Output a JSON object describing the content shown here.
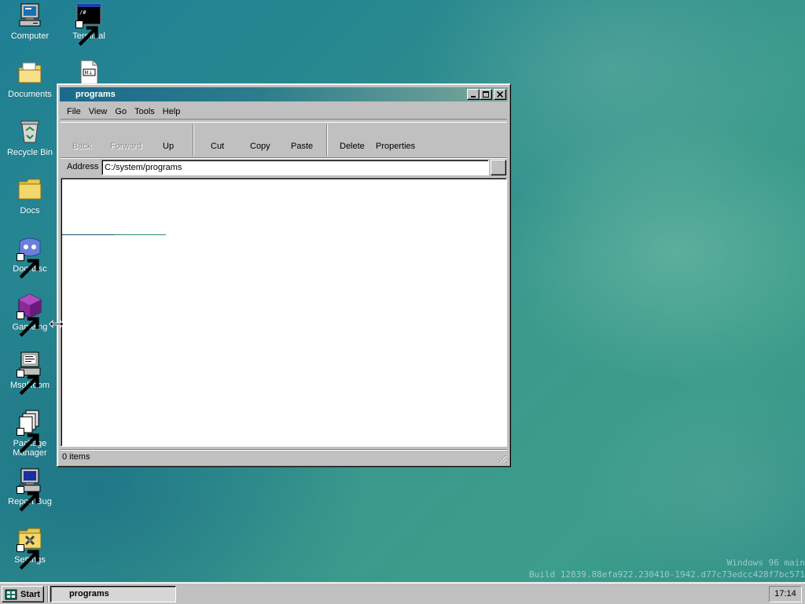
{
  "desktop": {
    "icons": [
      {
        "label": "Computer",
        "icon": "computer-icon"
      },
      {
        "label": "Terminal",
        "icon": "terminal-icon"
      },
      {
        "label": "Documents",
        "icon": "folder-documents-icon"
      },
      {
        "label": "Recycle Bin",
        "icon": "recycle-bin-icon"
      },
      {
        "label": "Docs",
        "icon": "folder-icon"
      },
      {
        "label": "Doordisc",
        "icon": "doordisc-icon"
      },
      {
        "label": "Gameing",
        "icon": "cube-icon"
      },
      {
        "label": "MsgRoom",
        "icon": "msgroom-icon"
      },
      {
        "label": "Package Manager",
        "icon": "package-manager-icon"
      },
      {
        "label": "Report Bug",
        "icon": "report-bug-icon"
      },
      {
        "label": "Settings",
        "icon": "settings-icon"
      }
    ],
    "file_icon": "markdown-file-icon",
    "file_icon_text": "M↓"
  },
  "window": {
    "title": "programs",
    "menu": [
      "File",
      "View",
      "Go",
      "Tools",
      "Help"
    ],
    "toolbar": {
      "back": "Back",
      "forward": "Forward",
      "up": "Up",
      "cut": "Cut",
      "copy": "Copy",
      "paste": "Paste",
      "delete": "Delete",
      "properties": "Properties"
    },
    "address_label": "Address",
    "address_value": "C:/system/programs",
    "status": "0 items"
  },
  "watermark": {
    "line1": "Windows 96 main",
    "line2": "Build 12839.88efa922.230410-1942.d77c73edcc428f7bc571"
  },
  "taskbar": {
    "start_label": "Start",
    "task_label": "programs",
    "clock": "17:14"
  },
  "colors": {
    "desktop_teal": "#2a8a8e",
    "titlebar_start": "#1b6a8c",
    "titlebar_end": "#7aa79a",
    "chrome_gray": "#c0c0c0"
  }
}
